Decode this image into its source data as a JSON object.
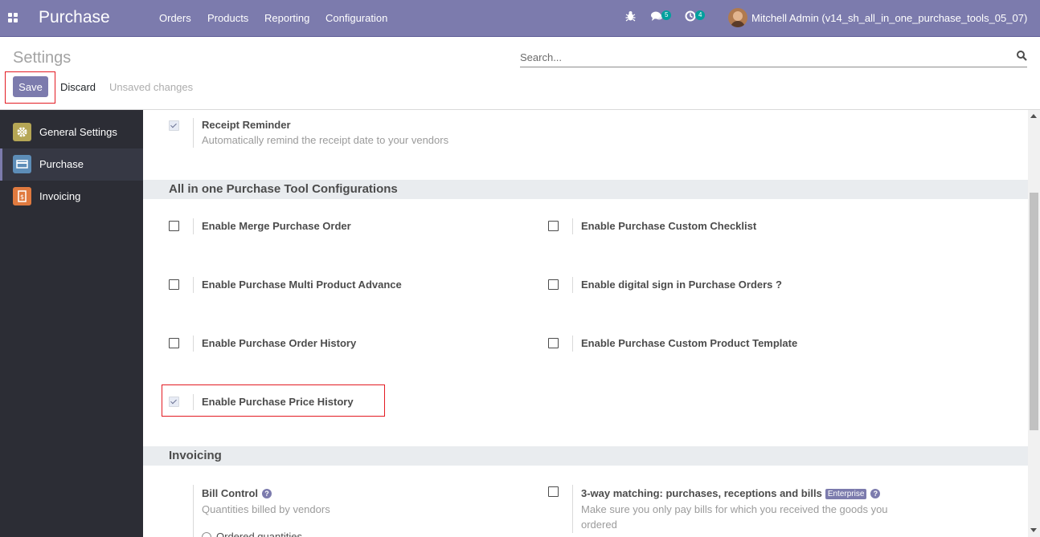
{
  "navbar": {
    "app_title": "Purchase",
    "menu": [
      "Orders",
      "Products",
      "Reporting",
      "Configuration"
    ],
    "messages_count": "5",
    "activities_count": "4",
    "user": "Mitchell Admin (v14_sh_all_in_one_purchase_tools_05_07)",
    "bg_color": "#7c7bad"
  },
  "control_panel": {
    "title": "Settings",
    "search_placeholder": "Search...",
    "save_label": "Save",
    "discard_label": "Discard",
    "status": "Unsaved changes"
  },
  "sidebar": {
    "items": [
      {
        "label": "General Settings",
        "icon": "gear-icon",
        "color": "#b5a655"
      },
      {
        "label": "Purchase",
        "icon": "purchase-card-icon",
        "color": "#5d8db8"
      },
      {
        "label": "Invoicing",
        "icon": "invoice-icon",
        "color": "#e07a3f"
      }
    ]
  },
  "content": {
    "receipt_reminder": {
      "title": "Receipt Reminder",
      "description": "Automatically remind the receipt date to your vendors",
      "checked": true
    },
    "tools_section": {
      "title": "All in one Purchase Tool Configurations",
      "settings": [
        {
          "label": "Enable Merge Purchase Order",
          "checked": false
        },
        {
          "label": "Enable Purchase Custom Checklist",
          "checked": false
        },
        {
          "label": "Enable Purchase Multi Product Advance",
          "checked": false
        },
        {
          "label": "Enable digital sign in Purchase Orders ?",
          "checked": false
        },
        {
          "label": "Enable Purchase Order History",
          "checked": false
        },
        {
          "label": "Enable Purchase Custom Product Template",
          "checked": false
        },
        {
          "label": "Enable Purchase Price History",
          "checked": true
        }
      ]
    },
    "invoicing_section": {
      "title": "Invoicing",
      "bill_control": {
        "title": "Bill Control",
        "description": "Quantities billed by vendors",
        "option": "Ordered quantities"
      },
      "three_way": {
        "title": "3-way matching: purchases, receptions and bills",
        "badge": "Enterprise",
        "description": "Make sure you only pay bills for which you received the goods you ordered",
        "checked": false
      }
    }
  }
}
